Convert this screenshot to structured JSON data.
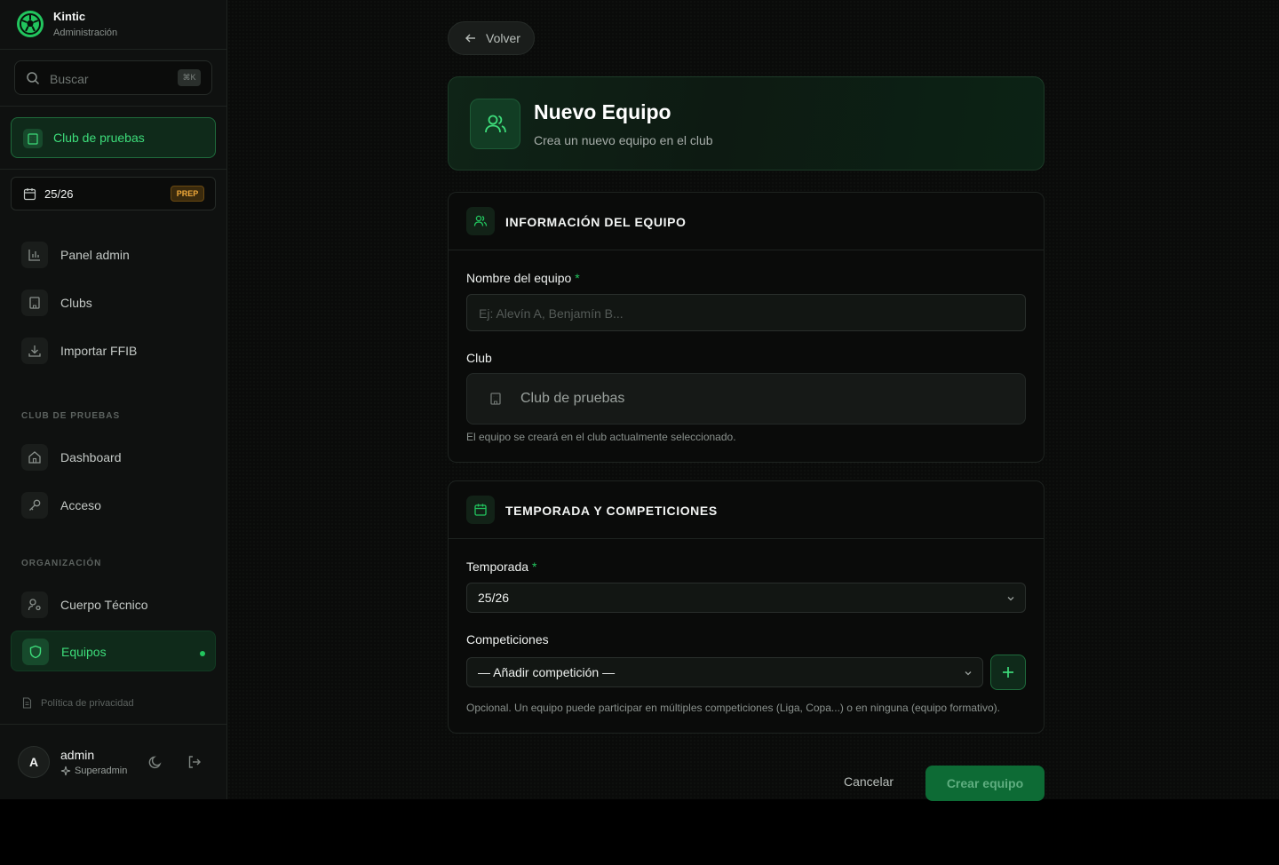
{
  "brand": {
    "name": "Kintic",
    "subtitle": "Administración"
  },
  "search": {
    "placeholder": "Buscar",
    "shortcut": "⌘K"
  },
  "club_selector": {
    "label": "Club de pruebas"
  },
  "season_selector": {
    "label": "25/26",
    "badge": "PREP"
  },
  "nav": {
    "admin_items": [
      {
        "label": "Panel admin",
        "icon": "bar-chart-icon"
      },
      {
        "label": "Clubs",
        "icon": "building-icon"
      },
      {
        "label": "Importar FFIB",
        "icon": "download-icon"
      }
    ],
    "club_section_label": "CLUB DE PRUEBAS",
    "club_items": [
      {
        "label": "Dashboard",
        "icon": "home-icon"
      },
      {
        "label": "Acceso",
        "icon": "key-icon"
      }
    ],
    "org_section_label": "ORGANIZACIÓN",
    "org_items": [
      {
        "label": "Cuerpo Técnico",
        "icon": "user-cog-icon"
      },
      {
        "label": "Equipos",
        "icon": "shield-icon",
        "active": true
      }
    ]
  },
  "privacy_link": "Política de privacidad",
  "user": {
    "initial": "A",
    "name": "admin",
    "role": "Superadmin"
  },
  "back_button": "Volver",
  "header": {
    "title": "Nuevo Equipo",
    "subtitle": "Crea un nuevo equipo en el club"
  },
  "team_info": {
    "title": "INFORMACIÓN DEL EQUIPO",
    "name_label": "Nombre del equipo",
    "required_mark": "*",
    "name_placeholder": "Ej: Alevín A, Benjamín B...",
    "club_label": "Club",
    "club_value": "Club de pruebas",
    "club_hint": "El equipo se creará en el club actualmente seleccionado."
  },
  "season_section": {
    "title": "TEMPORADA Y COMPETICIONES",
    "season_label": "Temporada",
    "season_value": "25/26",
    "competitions_label": "Competiciones",
    "competitions_value": "— Añadir competición —",
    "competitions_hint": "Opcional. Un equipo puede participar en múltiples competiciones (Liga, Copa...) o en ninguna (equipo formativo)."
  },
  "actions": {
    "cancel": "Cancelar",
    "create": "Crear equipo"
  },
  "colors": {
    "accent": "#22c55e",
    "accent_text": "#3ddc7a",
    "background": "#0a0b0a",
    "badge": "#f0a93a"
  }
}
